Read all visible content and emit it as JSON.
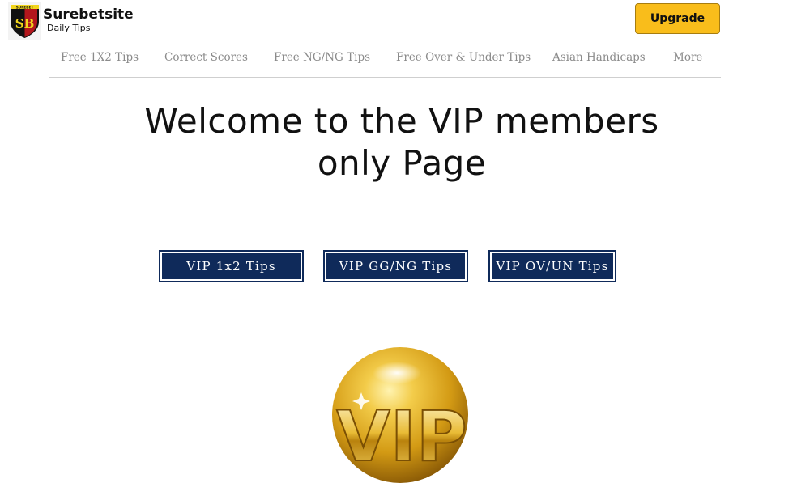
{
  "header": {
    "badge_text": "SUREBET",
    "monogram": "SB",
    "brand_name": "Surebetsite",
    "tagline": "Daily Tips",
    "upgrade_label": "Upgrade"
  },
  "nav": {
    "items": [
      {
        "label": "Free 1X2 Tips"
      },
      {
        "label": "Correct Scores"
      },
      {
        "label": "Free NG/NG Tips"
      },
      {
        "label": "Free Over & Under Tips"
      },
      {
        "label": "Asian Handicaps"
      },
      {
        "label": "More"
      }
    ]
  },
  "main": {
    "headline_line1": "Welcome to the VIP members",
    "headline_line2": "only Page",
    "buttons": [
      {
        "label": "VIP 1x2 Tips"
      },
      {
        "label": "VIP GG/NG Tips"
      },
      {
        "label": "VIP OV/UN Tips"
      }
    ],
    "vip_image_text": "VIP"
  },
  "colors": {
    "upgrade_bg": "#f9bd1b",
    "vip_button_bg": "#0f2a5a",
    "nav_text": "#8b8b8b",
    "gold": "#d8a21c"
  }
}
